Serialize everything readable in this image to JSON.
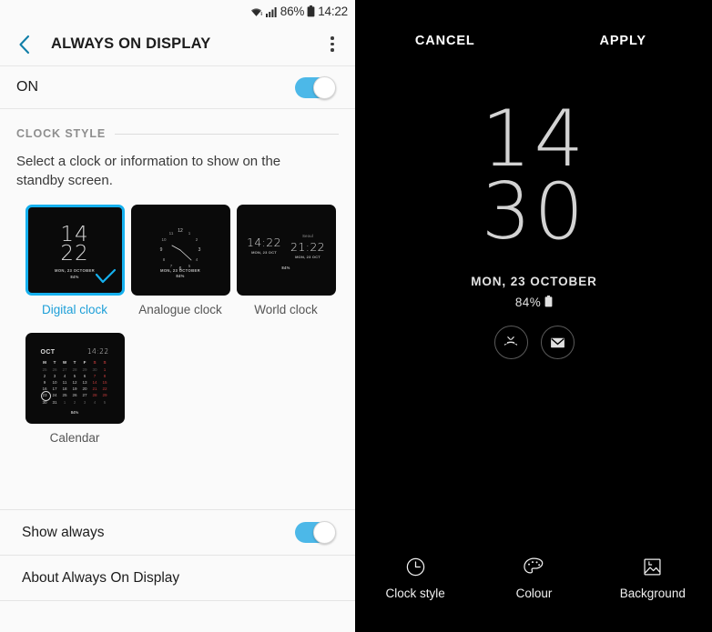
{
  "status_bar": {
    "wifi_icon": "wifi-icon",
    "signal_icon": "signal-bars-icon",
    "battery_percent": "86%",
    "battery_icon": "battery-icon",
    "time": "14:22"
  },
  "app_bar": {
    "back_icon": "back-chevron-icon",
    "title": "ALWAYS ON DISPLAY",
    "overflow_icon": "overflow-menu-icon"
  },
  "master_toggle": {
    "label": "ON",
    "state": "on",
    "accent": "#4cb8e8"
  },
  "clock_style": {
    "section_title": "CLOCK STYLE",
    "description": "Select a clock or information to show on the standby screen.",
    "selected_index": 0,
    "selected_accent": "#15b0ee",
    "options": [
      {
        "label": "Digital clock",
        "selected": true,
        "preview": {
          "hour": "14",
          "minute": "22",
          "date": "MON, 23 OCTOBER",
          "battery": "84%"
        }
      },
      {
        "label": "Analogue clock",
        "selected": false,
        "preview": {
          "date": "MON, 23 OCTOBER",
          "battery": "84%",
          "numerals": [
            "12",
            "1",
            "2",
            "3",
            "4",
            "5",
            "6",
            "7",
            "8",
            "9",
            "10",
            "11"
          ]
        }
      },
      {
        "label": "World clock",
        "selected": false,
        "preview": {
          "left_city": "",
          "left_time": "14:22",
          "left_date": "MON, 23 OCT",
          "right_city": "Seoul",
          "right_time": "21:22",
          "right_date": "MON, 23 OCT",
          "battery": "84%"
        }
      },
      {
        "label": "Calendar",
        "selected": false,
        "preview": {
          "month": "OCT",
          "time": "14:22",
          "battery": "84%",
          "weekdays": [
            "M",
            "T",
            "W",
            "T",
            "F",
            "S",
            "S"
          ],
          "weeks": [
            [
              "25",
              "26",
              "27",
              "28",
              "29",
              "30",
              "1"
            ],
            [
              "2",
              "3",
              "4",
              "5",
              "6",
              "7",
              "8"
            ],
            [
              "9",
              "10",
              "11",
              "12",
              "13",
              "14",
              "15"
            ],
            [
              "16",
              "17",
              "18",
              "19",
              "20",
              "21",
              "22"
            ],
            [
              "23",
              "24",
              "25",
              "26",
              "27",
              "28",
              "29"
            ],
            [
              "30",
              "31",
              "1",
              "2",
              "3",
              "4",
              "5"
            ]
          ],
          "today": "23"
        }
      }
    ]
  },
  "settings_rows": [
    {
      "label": "Show always",
      "has_toggle": true,
      "state": "on"
    },
    {
      "label": "About Always On Display",
      "has_toggle": false
    }
  ],
  "aod_preview": {
    "cancel_label": "CANCEL",
    "apply_label": "APPLY",
    "hour": "14",
    "minute": "30",
    "date": "MON, 23 OCTOBER",
    "battery": "84%",
    "battery_icon": "battery-icon",
    "notification_icons": [
      {
        "name": "missed-call-icon"
      },
      {
        "name": "message-envelope-icon"
      }
    ],
    "tabs": [
      {
        "label": "Clock style",
        "icon": "clock-icon"
      },
      {
        "label": "Colour",
        "icon": "palette-icon"
      },
      {
        "label": "Background",
        "icon": "image-icon"
      }
    ]
  }
}
